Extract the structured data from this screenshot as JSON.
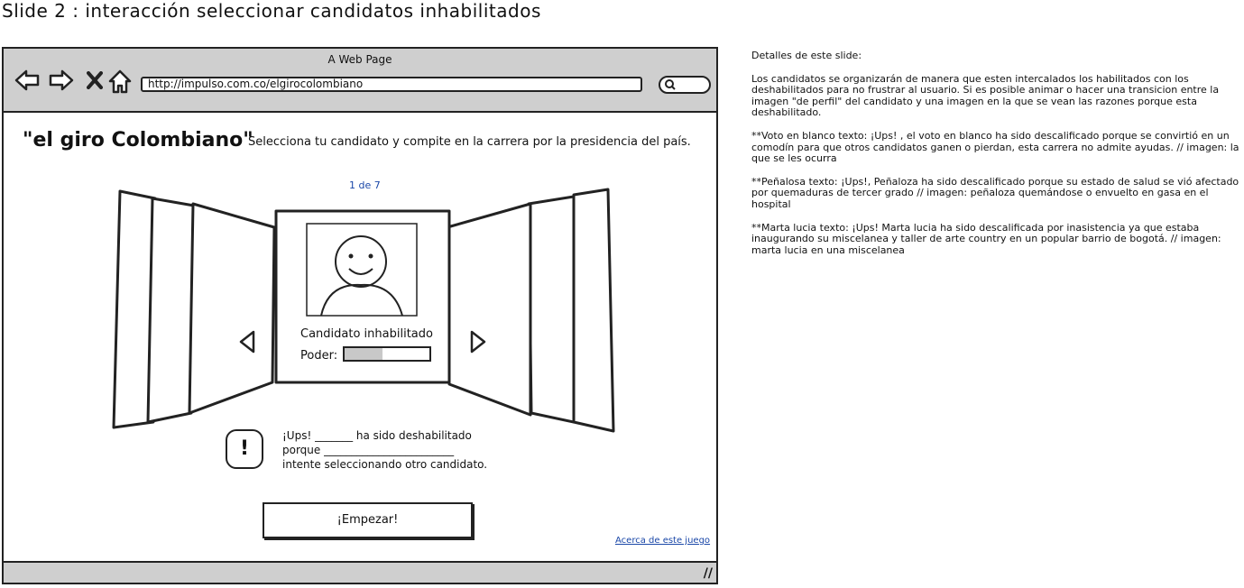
{
  "slide": {
    "title": "Slide 2 :  interacción seleccionar candidatos inhabilitados"
  },
  "browser": {
    "window_title": "A Web Page",
    "url": "http://impulso.com.co/elgirocolombiano",
    "nav_icons": [
      "back-arrow-icon",
      "forward-arrow-icon",
      "close-x-icon",
      "home-icon"
    ]
  },
  "page": {
    "brand": "\"el giro Colombiano\"",
    "tagline": "Selecciona tu candidato y compite en la carrera por la presidencia del país.",
    "counter": "1 de 7",
    "card": {
      "label": "Candidato inhabilitado",
      "poder_label": "Poder:",
      "poder_value": 0.45
    },
    "alert": {
      "line1": "¡Ups! _______ ha sido deshabilitado",
      "line2": "porque ________________________",
      "line3": "intente seleccionando  otro candidato."
    },
    "start_button": "¡Empezar!",
    "about_link": "Acerca de este juego"
  },
  "notes": {
    "heading": "Detalles de este slide:",
    "p1": "Los candidatos se organizarán de manera que esten intercalados los habilitados con los deshabilitados para no frustrar al usuario. Si es posible animar o hacer una transicion entre la imagen \"de perfil\" del candidato y una imagen en la que se vean las razones porque esta deshabilitado.",
    "p2": "**Voto en blanco texto: ¡Ups! , el voto en blanco ha sido descalificado porque se convirtió en un comodín para que otros candidatos ganen o pierdan, esta carrera no admite ayudas. // imagen: la que se les ocurra",
    "p3": "**Peñalosa texto: ¡Ups!, Peñaloza ha sido descalificado porque su estado de salud se vió afectado por quemaduras de tercer grado // imagen: peñaloza quemándose o envuelto en gasa en el hospital",
    "p4": "**Marta lucia texto: ¡Ups! Marta lucia ha sido descalificada por inasistencia ya que estaba inaugurando su miscelanea y taller de arte country en un popular barrio de bogotá. // imagen: marta lucia en una miscelanea"
  },
  "colors": {
    "chrome": "#cfcfcf",
    "link": "#1a47a8",
    "stroke": "#222222"
  }
}
